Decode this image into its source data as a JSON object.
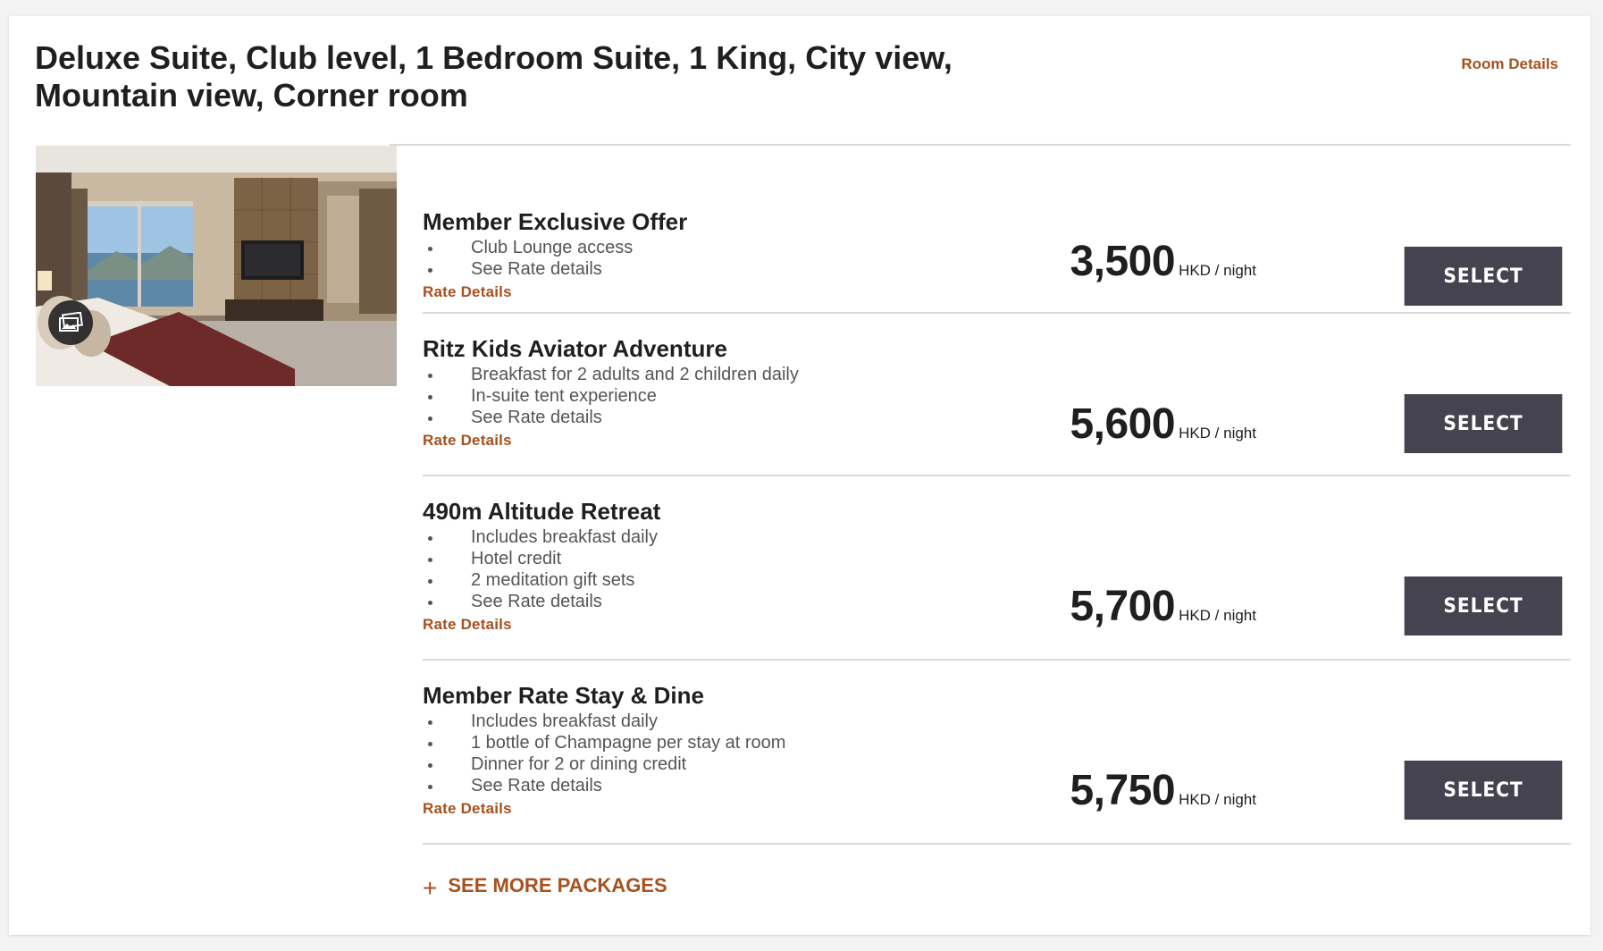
{
  "room": {
    "title": "Deluxe Suite, Club level, 1 Bedroom Suite, 1 King, City view, Mountain view, Corner room",
    "details_link": "Room Details"
  },
  "packages": [
    {
      "name": "Member Exclusive Offer",
      "features": [
        "Club Lounge access",
        "See Rate details"
      ],
      "rate_details": "Rate Details",
      "price": "3,500",
      "unit": "HKD / night",
      "select": "SELECT"
    },
    {
      "name": "Ritz Kids Aviator Adventure",
      "features": [
        "Breakfast for 2 adults and 2 children daily",
        "In-suite tent experience",
        "See Rate details"
      ],
      "rate_details": "Rate Details",
      "price": "5,600",
      "unit": "HKD / night",
      "select": "SELECT"
    },
    {
      "name": "490m Altitude Retreat",
      "features": [
        "Includes breakfast daily",
        "Hotel credit",
        "2 meditation gift sets",
        "See Rate details"
      ],
      "rate_details": "Rate Details",
      "price": "5,700",
      "unit": "HKD / night",
      "select": "SELECT"
    },
    {
      "name": "Member Rate Stay & Dine",
      "features": [
        "Includes breakfast daily",
        "1 bottle of Champagne per stay at room",
        "Dinner for 2 or dining credit",
        "See Rate details"
      ],
      "rate_details": "Rate Details",
      "price": "5,750",
      "unit": "HKD / night",
      "select": "SELECT"
    }
  ],
  "see_more": {
    "icon": "plus-icon",
    "label": "SEE MORE PACKAGES"
  },
  "icons": {
    "gallery": "gallery-icon"
  },
  "colors": {
    "accent": "#a8501e",
    "button": "#44434f",
    "text": "#1f1f1f"
  }
}
